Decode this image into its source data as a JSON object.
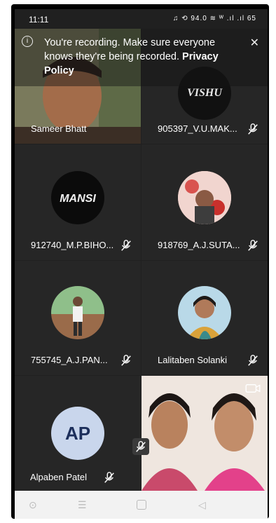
{
  "status_bar": {
    "time": "11:11",
    "icons_text": "♫ ⟲ 94.0 ≋ ᵂ .ıl .ıl 65"
  },
  "recording_banner": {
    "message": "You're recording. Make sure everyone knows they're being recorded.",
    "link": "Privacy Policy"
  },
  "participants": [
    {
      "name": "Sameer Bhatt",
      "muted": false
    },
    {
      "name": "905397_V.U.MAK...",
      "muted": true,
      "logo_text": "VISHU"
    },
    {
      "name": "912740_M.P.BIHO...",
      "muted": true,
      "logo_text": "MANSI"
    },
    {
      "name": "918769_A.J.SUTA...",
      "muted": true
    },
    {
      "name": "755745_A.J.PAN...",
      "muted": true
    },
    {
      "name": "Lalitaben Solanki",
      "muted": true
    },
    {
      "name": "Alpaben Patel",
      "muted": true,
      "initials": "AP"
    }
  ],
  "self_view": {
    "muted": true
  },
  "nav_bar": {
    "items": [
      "circle",
      "menu",
      "home",
      "back"
    ]
  },
  "colors": {
    "tile_bg": "#262626",
    "avatar_initials_bg": "#c9d6ec"
  }
}
